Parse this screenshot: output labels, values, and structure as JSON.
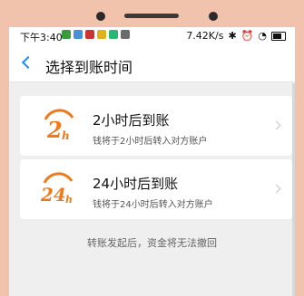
{
  "status_bar": {
    "time": "下午3:40",
    "network_speed": "7.42K/s",
    "icon_names": [
      "wechat-icon",
      "message-icon",
      "app-icon",
      "app-icon",
      "app-icon",
      "app-icon"
    ]
  },
  "nav": {
    "title": "选择到账时间"
  },
  "options": [
    {
      "badge": "2h",
      "title": "2小时后到账",
      "description": "钱将于2小时后转入对方账户"
    },
    {
      "badge": "24h",
      "title": "24小时后到账",
      "description": "钱将于24小时后转入对方账户"
    }
  ],
  "note": "转账发起后，资金将无法撤回",
  "colors": {
    "accent": "#1a8cff",
    "logo_orange": "#f07a1a"
  }
}
